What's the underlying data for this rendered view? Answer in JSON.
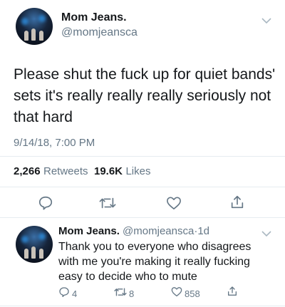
{
  "main_tweet": {
    "author_name": "Mom Jeans.",
    "handle": "@momjeansca",
    "text_lines": [
      "Please shut the fuck up for quiet bands'",
      "sets it's really really really seriously not",
      "that hard"
    ],
    "timestamp": "9/14/18, 7:00 PM",
    "retweets_count": "2,266",
    "retweets_label": "Retweets",
    "likes_count": "19.6K",
    "likes_label": "Likes"
  },
  "reply": {
    "author_name": "Mom Jeans.",
    "handle": "@momjeansca",
    "separator": "·",
    "age": "1d",
    "text_lines": [
      "Thank you to everyone who disagrees",
      "with me you're making it really fucking",
      "easy to decide who to mute"
    ],
    "reply_count": "4",
    "retweet_count": "8",
    "like_count": "858"
  },
  "icons": [
    "reply-icon",
    "retweet-icon",
    "like-icon",
    "share-icon",
    "chevron-down-icon"
  ],
  "colors": {
    "text": "#14171a",
    "secondary": "#657786",
    "divider": "#e6ecf0",
    "icon": "#657786"
  }
}
